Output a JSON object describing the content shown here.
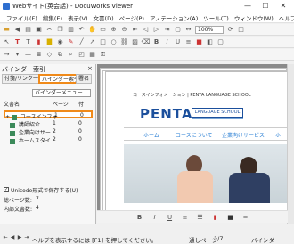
{
  "window": {
    "title": "Webサイト(英会話) - DocuWorks Viewer",
    "minimize": "—",
    "maximize": "☐",
    "close": "✕"
  },
  "menu": [
    "ファイル(F)",
    "編集(E)",
    "表示(V)",
    "文書(D)",
    "ページ(P)",
    "アノテーション(A)",
    "ツール(T)",
    "ウィンドウ(W)",
    "ヘルプ(H)"
  ],
  "toolbar": {
    "zoom": "100%"
  },
  "panel": {
    "title": "バインダー索引",
    "close": "×",
    "tabs": [
      "付箋/リンク一覧",
      "バインダー索引",
      "署名"
    ],
    "dropdown": "バインダーメニュー",
    "table_head": {
      "col_doc": "文書名",
      "col_page": "ページ",
      "col_ann": "付"
    },
    "rows": [
      {
        "expand": "+",
        "name": "コースインフォ",
        "page": "1",
        "count": "0"
      },
      {
        "expand": "",
        "name": "講師紹介",
        "page": "1",
        "count": "0"
      },
      {
        "expand": "",
        "name": "企業向けサー",
        "page": "2",
        "count": "0"
      },
      {
        "expand": "",
        "name": "ホームスタイ",
        "page": "2",
        "count": "0"
      }
    ],
    "unicode_label": "Unicode形式で保存する(U)",
    "total_pages_label": "総ページ数:",
    "total_pages": "7",
    "docs_label": "内部文書数:",
    "docs": "4"
  },
  "document": {
    "header": "コースインフォメーション | PENTA LANGUAGE SCHOOL",
    "brand": "PENTA",
    "brand_sub": "LANGUAGE SCHOOL",
    "nav": [
      "ホーム",
      "コースについて",
      "企業向けサービス",
      "ホ"
    ],
    "nav_color": "#2a7fd4",
    "brand_color": "#1b4f9c"
  },
  "status": {
    "help": "ヘルプを表示するには [F1] を押してください。",
    "page": "通しページ",
    "page_value": "1/7",
    "mode": "バインダー"
  }
}
